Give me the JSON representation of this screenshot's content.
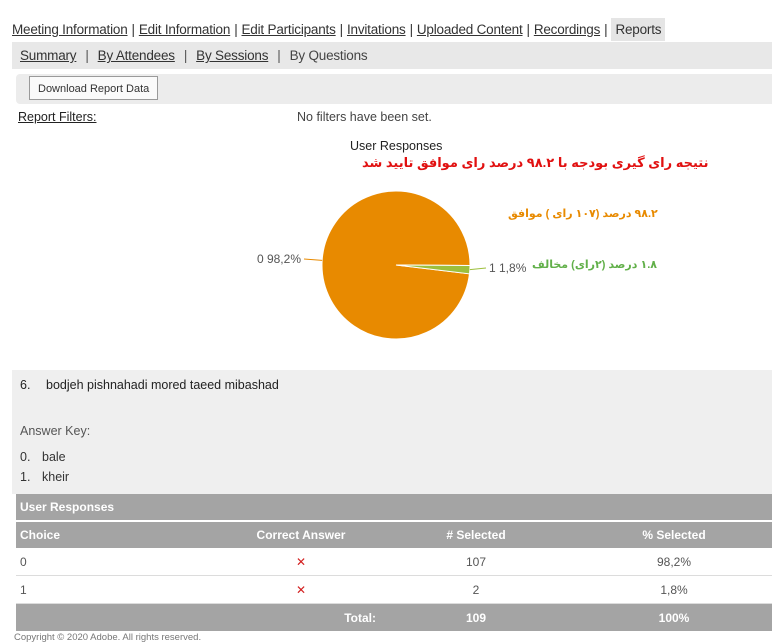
{
  "nav": {
    "tabs": [
      {
        "label": "Meeting Information"
      },
      {
        "label": "Edit Information"
      },
      {
        "label": "Edit Participants"
      },
      {
        "label": "Invitations"
      },
      {
        "label": "Uploaded Content"
      },
      {
        "label": "Recordings"
      },
      {
        "label": "Reports"
      }
    ],
    "active_tab": "Reports"
  },
  "subnav": {
    "items": [
      {
        "label": "Summary"
      },
      {
        "label": "By Attendees"
      },
      {
        "label": "By Sessions"
      },
      {
        "label": "By Questions"
      }
    ],
    "active": "By Questions"
  },
  "toolbar": {
    "download_label": "Download Report Data"
  },
  "filters": {
    "label": "Report Filters:",
    "value": "No filters have been set."
  },
  "chart_data": {
    "type": "pie",
    "title": "User Responses",
    "subtitle": "نتیجه رای گیری بودجه با ۹۸.۲ درصد رای موافق تایید شد",
    "categories": [
      "0",
      "1"
    ],
    "values": [
      98.2,
      1.8
    ],
    "slice_labels": [
      "0 98,2%",
      "1 1,8%"
    ],
    "colors": [
      "#e88a00",
      "#9dbf3c"
    ],
    "annotations": [
      {
        "text": "۹۸.۲ درصد (۱۰۷ رای ) موافق",
        "color": "#e88a00"
      },
      {
        "text": "۱.۸ درصد (۲رای) مخالف",
        "color": "#62b04a"
      }
    ]
  },
  "question": {
    "number": "6.",
    "text": "bodjeh pishnahadi mored taeed mibashad",
    "answer_key_label": "Answer Key:",
    "answers": [
      {
        "index": "0.",
        "text": "bale"
      },
      {
        "index": "1.",
        "text": "kheir"
      }
    ]
  },
  "table": {
    "caption": "User Responses",
    "headers": [
      "Choice",
      "Correct Answer",
      "# Selected",
      "% Selected"
    ],
    "rows": [
      {
        "choice": "0",
        "correct": "✕",
        "selected": "107",
        "percent": "98,2%"
      },
      {
        "choice": "1",
        "correct": "✕",
        "selected": "2",
        "percent": "1,8%"
      }
    ],
    "total": {
      "label": "Total:",
      "selected": "109",
      "percent": "100%"
    }
  },
  "footer": {
    "copyright": "Copyright © 2020 Adobe. All rights reserved."
  }
}
